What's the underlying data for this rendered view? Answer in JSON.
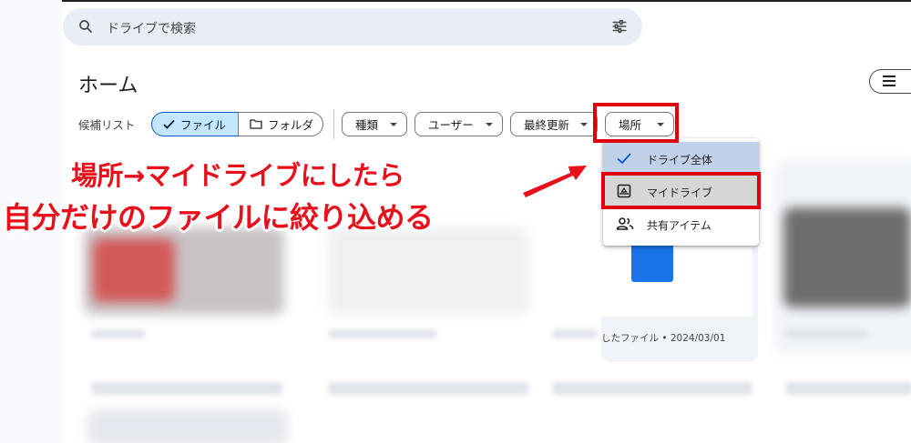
{
  "search": {
    "placeholder": "ドライブで検索"
  },
  "page_title": "ホーム",
  "filter": {
    "label": "候補リスト",
    "file_label": "ファイル",
    "folder_label": "フォルダ",
    "chips": {
      "type": "種類",
      "user": "ユーザー",
      "modified": "最終更新",
      "location": "場所"
    }
  },
  "location_menu": {
    "items": [
      {
        "label": "ドライブ全体",
        "icon": "check-icon",
        "selected": true
      },
      {
        "label": "マイドライブ",
        "icon": "my-drive-icon",
        "selected": false
      },
      {
        "label": "共有アイテム",
        "icon": "people-icon",
        "selected": false
      }
    ]
  },
  "annotation": {
    "line1": "場所→マイドライブにしたら",
    "line2": "自分だけのファイルに絞り込める"
  },
  "file_card": {
    "meta": "したファイル • 2024/03/01"
  },
  "colors": {
    "annotation_red": "#e8101a",
    "highlight_box": "#e0000b",
    "accent_blue": "#0b57d0",
    "chip_selected": "#c2e7ff"
  }
}
